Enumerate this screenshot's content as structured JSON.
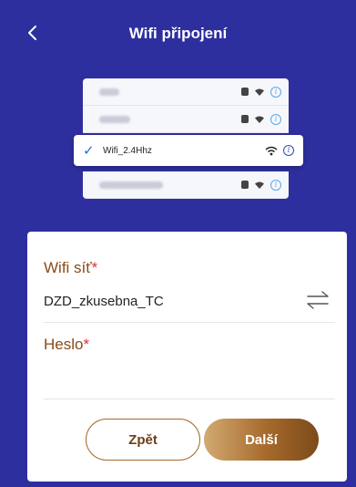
{
  "header": {
    "back_icon": "chevron-left-icon",
    "title": "Wifi připojení"
  },
  "illustration": {
    "selected_network": "Wifi_2.4Hhz",
    "check_icon": "checkmark-icon"
  },
  "form": {
    "wifi_label": "Wifi síť",
    "required_marker": "*",
    "wifi_value": "DZD_zkusebna_TC",
    "swap_icon": "swap-arrows-icon",
    "password_label": "Heslo",
    "password_value": ""
  },
  "buttons": {
    "back_label": "Zpět",
    "next_label": "Další"
  },
  "colors": {
    "background": "#2e2f9e",
    "label_color": "#8a4a17",
    "required_color": "#e0312c",
    "accent_gold": "#a6692b"
  }
}
